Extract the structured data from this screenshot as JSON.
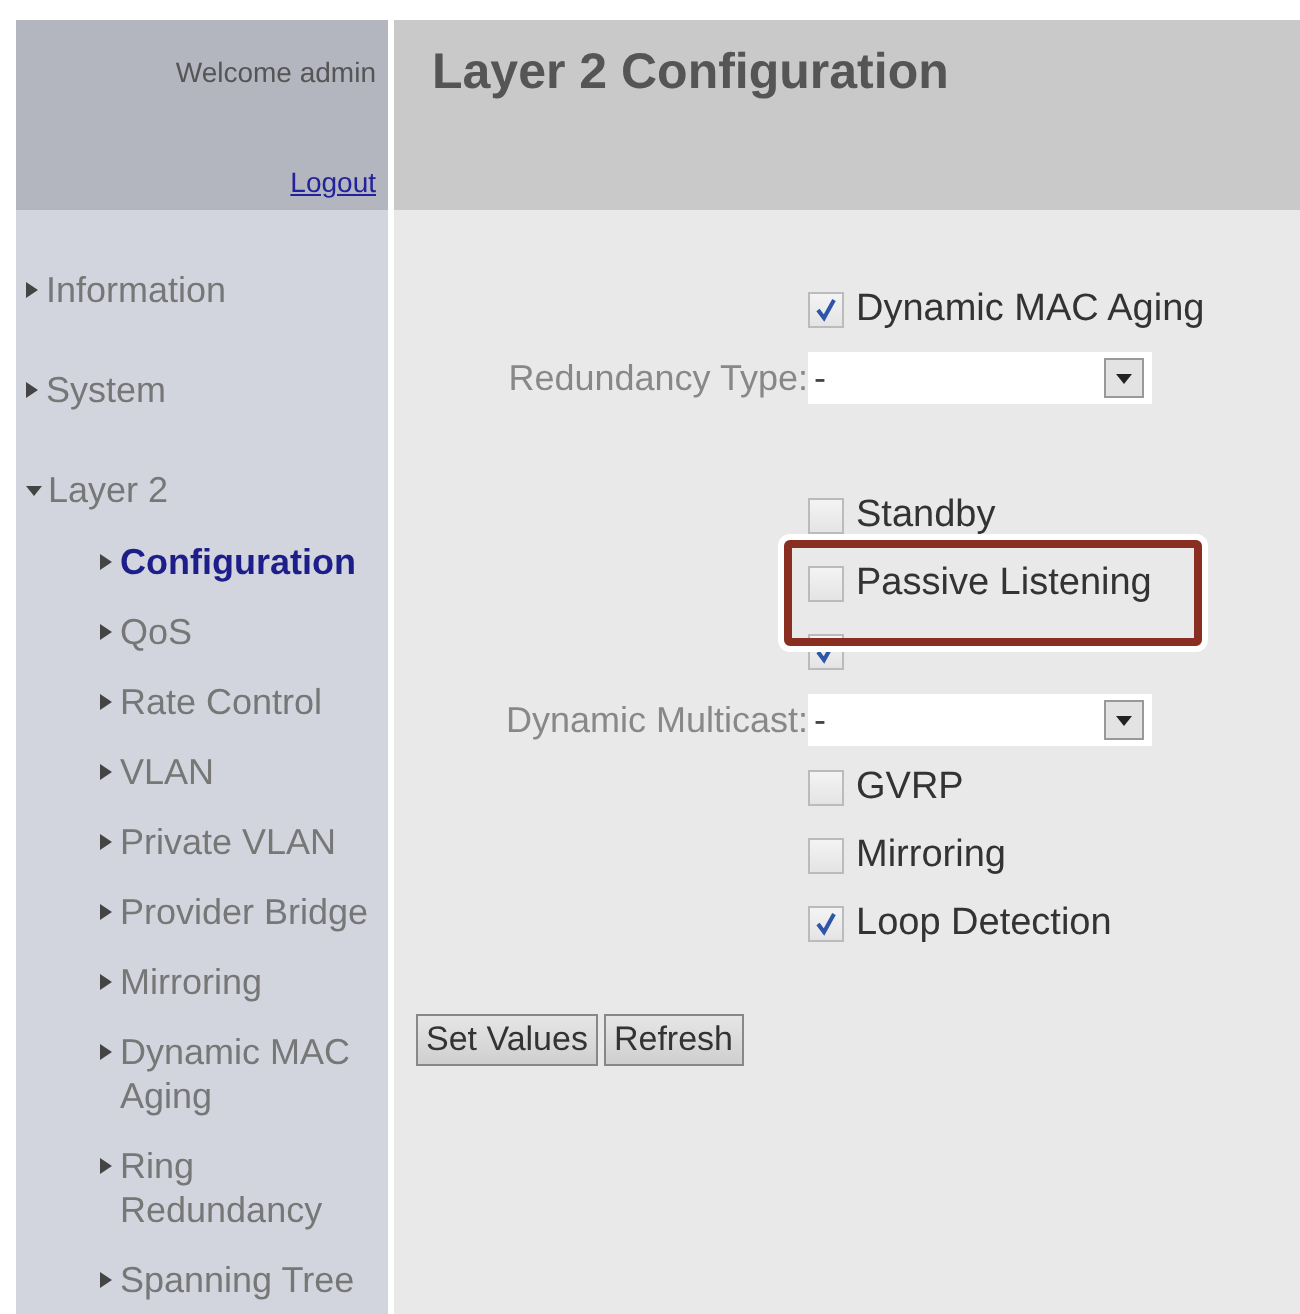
{
  "header": {
    "welcome": "Welcome admin",
    "logout": "Logout",
    "title": "Layer 2 Configuration"
  },
  "sidebar": {
    "items": [
      {
        "label": "Information",
        "expanded": false
      },
      {
        "label": "System",
        "expanded": false
      },
      {
        "label": "Layer 2",
        "expanded": true,
        "children": [
          {
            "label": "Configuration",
            "selected": true
          },
          {
            "label": "QoS",
            "selected": false
          },
          {
            "label": "Rate Control",
            "selected": false
          },
          {
            "label": "VLAN",
            "selected": false
          },
          {
            "label": "Private VLAN",
            "selected": false
          },
          {
            "label": "Provider Bridge",
            "selected": false
          },
          {
            "label": "Mirroring",
            "selected": false
          },
          {
            "label": "Dynamic MAC Aging",
            "selected": false
          },
          {
            "label": "Ring Redundancy",
            "selected": false
          },
          {
            "label": "Spanning Tree",
            "selected": false
          }
        ]
      }
    ]
  },
  "form": {
    "sections": [
      [
        {
          "kind": "checkbox",
          "label": "Dynamic MAC Aging",
          "checked": true
        },
        {
          "kind": "select",
          "label": "Redundancy Type:",
          "option": "-"
        }
      ],
      [
        {
          "kind": "checkbox",
          "label": "Standby",
          "checked": false
        },
        {
          "kind": "checkbox",
          "label": "Passive Listening",
          "checked": false,
          "highlighted": true
        },
        {
          "kind": "checkbox",
          "checked": true
        },
        {
          "kind": "select",
          "label": "Dynamic Multicast:",
          "option": "-"
        },
        {
          "kind": "checkbox",
          "label": "GVRP",
          "checked": false
        },
        {
          "kind": "checkbox",
          "label": "Mirroring",
          "checked": false
        },
        {
          "kind": "checkbox",
          "label": "Loop Detection",
          "checked": true
        }
      ]
    ],
    "buttons": [
      "Set Values",
      "Refresh"
    ]
  }
}
